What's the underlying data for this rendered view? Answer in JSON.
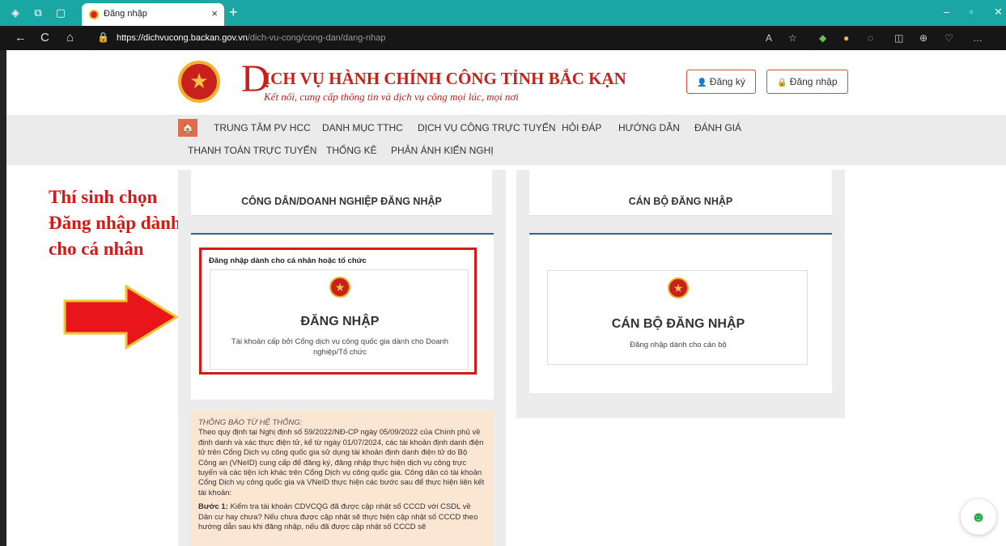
{
  "browser": {
    "tab_title": "Đăng nhập",
    "tab_close": "×",
    "new_tab": "+",
    "url_domain": "https://dichvucong.backan.gov.vn",
    "url_path": "/dich-vu-cong/cong-dan/dang-nhap",
    "icons": {
      "back": "←",
      "refresh": "C",
      "home": "⌂",
      "lock": "🔒",
      "read_aloud": "A",
      "favorite": "☆",
      "more": "…",
      "minimize": "–",
      "restore": "▫",
      "close": "✕"
    }
  },
  "header": {
    "brand_initial": "D",
    "brand_title": "ỊCH VỤ HÀNH CHÍNH CÔNG TỈNH BẮC KẠN",
    "brand_tagline": "Kết nối, cung cấp thông tin và dịch vụ công mọi lúc, mọi nơi",
    "register_label": "Đăng ký",
    "login_label": "Đăng nhập",
    "register_icon": "👤",
    "login_icon": "🔒"
  },
  "menu": {
    "home_icon": "🏠",
    "row1": [
      "TRUNG TÂM PV HCC",
      "DANH MỤC TTHC",
      "DỊCH VỤ CÔNG TRỰC TUYẾN",
      "HỎI ĐÁP",
      "HƯỚNG DẪN",
      "ĐÁNH GIÁ"
    ],
    "row2": [
      "THANH TOÁN TRỰC TUYẾN",
      "THỐNG KÊ",
      "PHẢN ÁNH KIẾN NGHỊ"
    ]
  },
  "annotation": {
    "text": "Thí sinh chọn Đăng nhập dành cho cá nhân",
    "arrow_color": "#e8161a",
    "arrow_border": "#f2c430"
  },
  "citizen_login": {
    "heading": "CÔNG DÂN/DOANH NGHIỆP ĐĂNG NHẬP",
    "caption": "Đăng nhập dành cho cá nhân hoặc tổ chức",
    "button_title": "ĐĂNG NHẬP",
    "description": "Tài khoản cấp bởi Cổng dịch vụ công quốc gia dành cho Doanh nghiệp/Tổ chức"
  },
  "officer_login": {
    "heading": "CÁN BỘ ĐĂNG NHẬP",
    "button_title": "CÁN BỘ ĐĂNG NHẬP",
    "description": "Đăng nhập dành cho cán bộ"
  },
  "notice": {
    "title": "THÔNG BÁO TỪ HỆ THỐNG:",
    "body": "Theo quy định tại Nghị định số 59/2022/NĐ-CP ngày 05/09/2022 của Chính phủ về định danh và xác thực điện tử, kể từ ngày 01/07/2024, các tài khoản định danh điện tử trên Cổng Dịch vụ công quốc gia sử dụng tài khoản định danh điện tử do Bộ Công an (VNeID) cung cấp để đăng ký, đăng nhập thực hiện dịch vụ công trực tuyến và các tiện ích khác trên Cổng Dịch vụ công quốc gia. Công dân có tài khoản Cổng Dịch vụ công quốc gia và VNeID thực hiện các bước sau để thực hiện liên kết tài khoản:",
    "step_label": "Bước 1:",
    "step_text": "Kiểm tra tài khoản CDVCQG đã được cập nhật số CCCD với CSDL về Dân cư hay chưa? Nếu chưa được cập nhật sẽ thực hiện cập nhật số CCCD theo hướng dẫn sau khi đăng nhập, nếu đã được cập nhật số CCCD sẽ"
  },
  "colors": {
    "tabbar": "#1aa7a3",
    "brand_red": "#c8201c",
    "menu_bg": "#ebebeb",
    "notice_bg": "#fbe6d4",
    "highlight_red": "#d61818"
  }
}
